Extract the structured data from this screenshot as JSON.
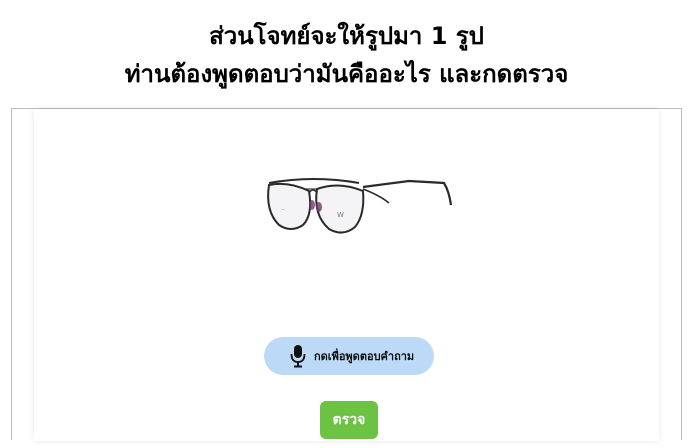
{
  "header": {
    "line1": "ส่วนโจทย์จะให้รูปมา 1 รูป",
    "line2": "ท่านต้องพูดตอบว่ามันคืออะไร และกดตรวจ"
  },
  "question": {
    "image_icon": "eyeglasses-icon"
  },
  "controls": {
    "speak_label": "กดเพื่อพูดตอบคำถาม",
    "speak_icon": "microphone-icon",
    "check_label": "ตรวจ"
  },
  "colors": {
    "speak_button_bg": "#bcd9f8",
    "check_button_bg": "#6cc243"
  }
}
